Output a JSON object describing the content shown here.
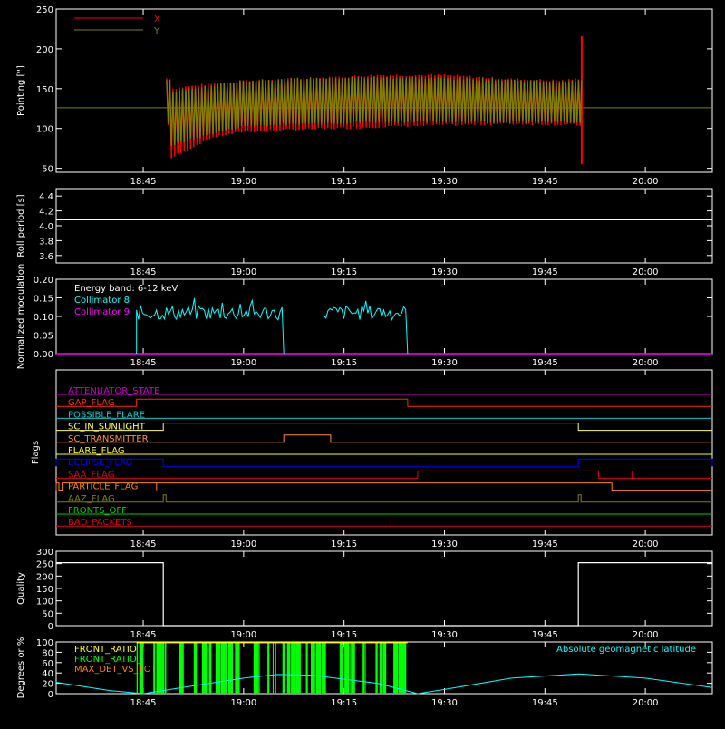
{
  "time_axis": {
    "domain_start": "18:32",
    "domain_end": "20:10",
    "ticks": [
      "18:45",
      "19:00",
      "19:15",
      "19:30",
      "19:45",
      "20:00"
    ]
  },
  "chart_data": [
    {
      "id": "pointing",
      "type": "line",
      "ylabel": "Pointing [\"]",
      "ylim": [
        45,
        250
      ],
      "yticks": [
        50,
        100,
        150,
        200,
        250
      ],
      "legend": {
        "placement": "top-left",
        "entries": [
          {
            "name": "X",
            "color": "#ff0000"
          },
          {
            "name": "Y",
            "color": "#808000"
          }
        ]
      },
      "reference_line": 126,
      "data_start": "18:48.5",
      "data_end": "19:50.5",
      "series": [
        {
          "name": "X",
          "color": "#ff0000",
          "time": [
            "18:49",
            "18:55",
            "19:00",
            "19:10",
            "19:20",
            "19:30",
            "19:40",
            "19:48",
            "19:50"
          ],
          "upper": [
            150,
            156,
            160,
            163,
            167,
            167,
            162,
            160,
            163
          ],
          "lower": [
            62,
            88,
            96,
            99,
            102,
            104,
            106,
            105,
            104
          ],
          "spike_end": [
            216,
            55
          ]
        },
        {
          "name": "Y",
          "color": "#808000",
          "time": [
            "18:49",
            "18:55",
            "19:00",
            "19:10",
            "19:20",
            "19:30",
            "19:40",
            "19:48",
            "19:50"
          ],
          "upper": [
            146,
            153,
            160,
            163,
            164,
            163,
            161,
            158,
            160
          ],
          "lower": [
            78,
            93,
            103,
            106,
            108,
            108,
            108,
            108,
            106
          ]
        }
      ]
    },
    {
      "id": "roll",
      "type": "line",
      "ylabel": "Roll period [s]",
      "ylim": [
        3.5,
        4.5
      ],
      "yticks": [
        3.6,
        3.8,
        4.0,
        4.2,
        4.4
      ],
      "series": [
        {
          "name": "",
          "color": "#ffffff",
          "value": 4.08
        }
      ]
    },
    {
      "id": "modulation",
      "type": "line",
      "ylabel": "Normalized modulation",
      "ylim": [
        0,
        0.2
      ],
      "yticks": [
        0.0,
        0.05,
        0.1,
        0.15,
        0.2
      ],
      "annotation": "Energy band: 6-12 keV",
      "legend": {
        "placement": "top-left",
        "entries": [
          {
            "name": "Collimator 8",
            "color": "#00ffff"
          },
          {
            "name": "Collimator 9",
            "color": "#ff00ff"
          }
        ]
      },
      "series": [
        {
          "name": "Collimator 8",
          "color": "#00ffff",
          "intervals": [
            [
              "18:44",
              "19:06"
            ],
            [
              "19:12",
              "19:24.5"
            ]
          ],
          "level": 0.11,
          "spread": 0.02
        },
        {
          "name": "Collimator 9",
          "color": "#ff00ff",
          "value": 0.0
        }
      ]
    },
    {
      "id": "flags",
      "type": "line",
      "ylabel": "Flags",
      "series": [
        {
          "name": "ATTENUATOR_STATE",
          "color": "#cc00cc",
          "steps": []
        },
        {
          "name": "GAP_FLAG",
          "color": "#ff2a00",
          "steps": [
            [
              "18:44",
              "19:24.5"
            ]
          ]
        },
        {
          "name": "POSSIBLE_FLARE",
          "color": "#00cccc",
          "steps": []
        },
        {
          "name": "SC_IN_SUNLIGHT",
          "color": "#ffff66",
          "steps": [
            [
              "18:48",
              "19:50"
            ]
          ]
        },
        {
          "name": "SC_TRANSMITTER",
          "color": "#ff8c33",
          "steps": [
            [
              "19:06",
              "19:13"
            ]
          ]
        },
        {
          "name": "FLARE_FLAG",
          "color": "#ffff00",
          "steps": []
        },
        {
          "name": "ECLIPSE_FLAG",
          "color": "#0000ff",
          "steps": [
            [
              "18:32",
              "18:48"
            ],
            [
              "19:50",
              "20:10"
            ]
          ]
        },
        {
          "name": "SAA_FLAG",
          "color": "#e0001a",
          "steps": [
            [
              "19:26",
              "19:53"
            ]
          ]
        },
        {
          "name": "PARTICLE_FLAG",
          "color": "#ff8800",
          "steps": [
            [
              "18:32",
              "18:32.4"
            ],
            [
              "18:32.9",
              "19:55"
            ]
          ]
        },
        {
          "name": "AAZ_FLAG",
          "color": "#808000",
          "steps": [
            [
              "18:48",
              "18:48.4"
            ],
            [
              "19:50",
              "19:50.4"
            ]
          ]
        },
        {
          "name": "FRONTS_OFF",
          "color": "#00cc00",
          "steps": []
        },
        {
          "name": "BAD_PACKETS",
          "color": "#e0001a",
          "steps": []
        }
      ]
    },
    {
      "id": "quality",
      "type": "line",
      "ylabel": "Quality",
      "ylim": [
        0,
        300
      ],
      "yticks": [
        0,
        50,
        100,
        150,
        200,
        250,
        300
      ],
      "series": [
        {
          "name": "",
          "color": "#ffffff",
          "time": [
            "18:32",
            "18:48",
            "18:48",
            "19:50",
            "19:50",
            "20:10"
          ],
          "values": [
            254,
            254,
            0,
            0,
            254,
            254
          ]
        }
      ]
    },
    {
      "id": "geomag",
      "type": "line",
      "ylabel": "Degrees or %",
      "ylim": [
        0,
        100
      ],
      "yticks": [
        0,
        20,
        40,
        60,
        80,
        100
      ],
      "legend": {
        "placement": "top-left",
        "entries": [
          {
            "name": "FRONT_RATIO",
            "color": "#ffff00"
          },
          {
            "name": "FRONT_RATIO_",
            "color": "#00ff00"
          },
          {
            "name": "MAX_DET_VS_TOT",
            "color": "#ff8000"
          }
        ]
      },
      "annotation": "Absolute geomagnetic latitude",
      "series": [
        {
          "name": "FRONT_RATIO_",
          "color": "#00ff00",
          "intervals": [
            [
              "18:44",
              "19:24.5"
            ]
          ],
          "level": 100
        },
        {
          "name": "Absolute geomagnetic latitude",
          "color": "#00ffff",
          "time": [
            "18:32",
            "18:40",
            "18:45",
            "18:50",
            "19:00",
            "19:05",
            "19:10",
            "19:20",
            "19:26",
            "19:30",
            "19:40",
            "19:50",
            "20:00",
            "20:10"
          ],
          "values": [
            22,
            6,
            0,
            10,
            30,
            37,
            36,
            20,
            0,
            8,
            30,
            38,
            30,
            12
          ]
        }
      ]
    }
  ]
}
